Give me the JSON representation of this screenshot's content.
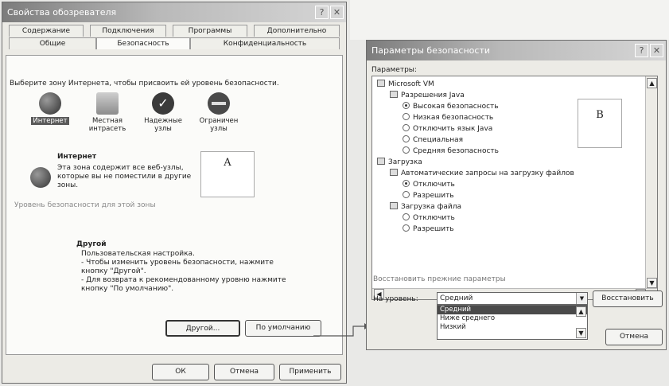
{
  "left_dialog": {
    "title": "Свойства обозревателя",
    "tabs_row1": [
      "Содержание",
      "Подключения",
      "Программы",
      "Дополнительно"
    ],
    "tabs_row2": [
      "Общие",
      "Безопасность",
      "Конфиденциальность"
    ],
    "zone_prompt": "Выберите зону Интернета, чтобы присвоить ей уровень безопасности.",
    "zones": [
      {
        "label": "Интернет",
        "selected": true
      },
      {
        "label": "Местная\nинтрасеть",
        "selected": false
      },
      {
        "label": "Надежные\nузлы",
        "selected": false
      },
      {
        "label": "Ограничен\nузлы",
        "selected": false
      }
    ],
    "zone_title": "Интернет",
    "zone_desc": [
      "Эта зона содержит все веб-узлы,",
      "которые вы не поместили в другие",
      "зоны."
    ],
    "box_a": "A",
    "security_level_label": "Уровень безопасности для этой зоны",
    "custom_title": "Другой",
    "custom_lines": [
      "Пользовательская настройка.",
      "- Чтобы изменить уровень безопасности, нажмите",
      "кнопку \"Другой\".",
      "- Для возврата к рекомендованному уровню нажмите",
      "кнопку \"По умолчанию\"."
    ],
    "btn_custom": "Другой...",
    "btn_default": "По умолчанию",
    "btn_ok": "ОК",
    "btn_cancel": "Отмена",
    "btn_apply": "Применить"
  },
  "right_dialog": {
    "title": "Параметры безопасности",
    "params_label": "Параметры:",
    "box_b": "B",
    "tree": [
      {
        "text": "Microsoft VM",
        "type": "folder",
        "level": 0
      },
      {
        "text": "Разрешения Java",
        "type": "folder",
        "level": 1
      },
      {
        "text": "Высокая безопасность",
        "type": "radio",
        "level": 2,
        "checked": true
      },
      {
        "text": "Низкая безопасность",
        "type": "radio",
        "level": 2,
        "checked": false
      },
      {
        "text": "Отключить язык Java",
        "type": "radio",
        "level": 2,
        "checked": false
      },
      {
        "text": "Специальная",
        "type": "radio",
        "level": 2,
        "checked": false
      },
      {
        "text": "Средняя безопасность",
        "type": "radio",
        "level": 2,
        "checked": false
      },
      {
        "text": "Загрузка",
        "type": "folder",
        "level": 0
      },
      {
        "text": "Автоматические запросы на загрузку файлов",
        "type": "folder",
        "level": 1
      },
      {
        "text": "Отключить",
        "type": "radio",
        "level": 2,
        "checked": true
      },
      {
        "text": "Разрешить",
        "type": "radio",
        "level": 2,
        "checked": false
      },
      {
        "text": "Загрузка файла",
        "type": "folder",
        "level": 1
      },
      {
        "text": "Отключить",
        "type": "radio",
        "level": 2,
        "checked": false
      },
      {
        "text": "Разрешить",
        "type": "radio",
        "level": 2,
        "checked": false
      }
    ],
    "restore_label": "Восстановить прежние параметры",
    "level_label": "На уровень:",
    "level_value": "Средний",
    "level_options": [
      "Средний",
      "Ниже среднего",
      "Низкий"
    ],
    "btn_restore": "Восстановить",
    "btn_cancel": "Отмена"
  },
  "colors": {
    "titlebar_gradient": [
      "#7c7c7c",
      "#d6d6d6"
    ],
    "dropdown_selected": "#4a4a4a"
  }
}
